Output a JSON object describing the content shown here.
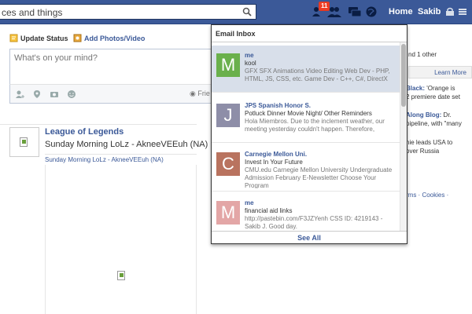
{
  "header": {
    "search_text": "ces and things",
    "badge_count": "11",
    "home_label": "Home",
    "user_name": "Sakib"
  },
  "composer": {
    "update_status_label": "Update Status",
    "add_photos_label": "Add Photos/Video",
    "placeholder": "What's on your mind?",
    "friends_label": "Frie"
  },
  "story": {
    "title": "League of Legends",
    "subtitle": "Sunday Morning LoLz - AkneeVEEuh (NA)",
    "link": "Sunday Morning LoLz - AkneeVEEuh (NA)"
  },
  "right_column": {
    "line1": "nd 1 other",
    "learn_more": "Learn More",
    "black_bold": "Black:",
    "black_text": " 'Orange is",
    "black_line2": "2 premiere date set",
    "along_bold": "Along Blog:",
    "along_text": " Dr.",
    "along_line2": "pipeline, with \"many",
    "usa_line1": "hie leads USA to",
    "usa_line2": "over Russia",
    "footer_links": "rms · Cookies ·"
  },
  "inbox": {
    "title": "Email Inbox",
    "see_all": "See All",
    "messages": [
      {
        "initial": "M",
        "color": "#6ab04c",
        "from": "me",
        "subject": "kool",
        "preview": "GFX SFX Animations Video Editing Web Dev - PHP, HTML, JS, CSS, etc. Game Dev - C++, C#, DirectX"
      },
      {
        "initial": "J",
        "color": "#8e8ea8",
        "from": "JPS Spanish Honor S.",
        "subject": "Potluck Dinner Movie Night/ Other Reminders",
        "preview": "Hola Miembros. Due to the inclement weather, our meeting yesterday couldn't happen. Therefore,"
      },
      {
        "initial": "C",
        "color": "#b9735f",
        "from": "Carnegie Mellon Uni.",
        "subject": "Invest In Your Future",
        "preview": "CMU.edu Carnegie Mellon University Undergraduate Admission February E-Newsletter Choose Your Program"
      },
      {
        "initial": "M",
        "color": "#e3a6a6",
        "from": "me",
        "subject": "financial aid links",
        "preview": "http://pastebin.com/F3JZYenh CSS ID: 4219143 - Sakib J. Good day."
      }
    ]
  }
}
